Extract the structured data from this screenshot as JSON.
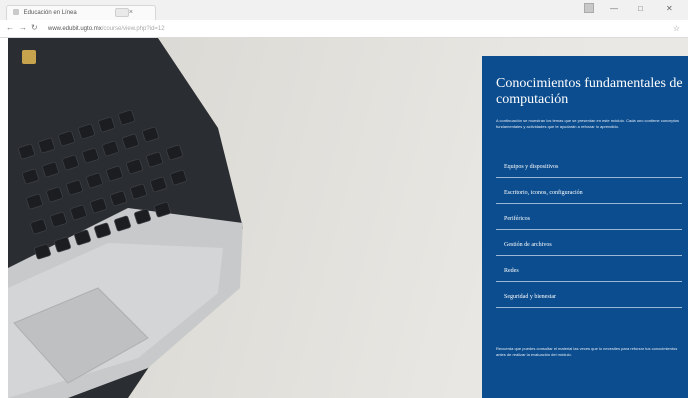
{
  "browser": {
    "tab_title": "Educación en Línea",
    "url_host": "www.edubit.ugto.mx",
    "url_path": "/course/view.php?id=12"
  },
  "page": {
    "panel_title": "Conocimientos fundamentales de computación",
    "intro": "A continuación se muestran los temas que se presentan en este módulo. Cada uno contiene conceptos fundamentales y actividades que te ayudarán a reforzar lo aprendido.",
    "menu": [
      {
        "label": "Equipos y dispositivos"
      },
      {
        "label": "Escritorio, iconos, configuración"
      },
      {
        "label": "Periféricos"
      },
      {
        "label": "Gestión de archivos"
      },
      {
        "label": "Redes"
      },
      {
        "label": "Seguridad y bienestar"
      }
    ],
    "footer": "Recuerda que puedes consultar el material las veces que lo necesites para reforzar tus conocimientos antes de realizar la evaluación del módulo."
  },
  "colors": {
    "panel": "#0c4d8f",
    "logo": "#c8a34e"
  }
}
